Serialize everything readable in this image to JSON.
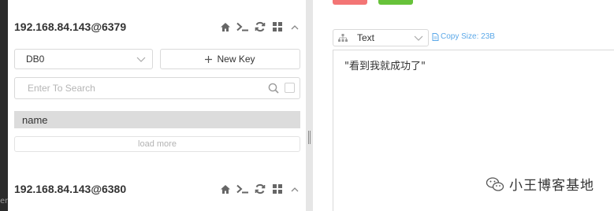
{
  "connections": [
    {
      "title": "192.168.84.143@6379",
      "icons": [
        "home-icon",
        "terminal-icon",
        "refresh-icon",
        "grid-icon",
        "chevron-up-icon"
      ],
      "db_select": {
        "value": "DB0"
      },
      "new_key_label": "New Key",
      "search": {
        "placeholder": "Enter To Search"
      },
      "keys": [
        "name"
      ],
      "load_more_label": "load more"
    },
    {
      "title": "192.168.84.143@6380",
      "icons": [
        "home-icon",
        "terminal-icon",
        "refresh-icon",
        "grid-icon",
        "chevron-up-icon"
      ]
    }
  ],
  "left_edge_fragment": "en",
  "detail": {
    "view_as": "Text",
    "copy_size_label": "Copy Size: 23B",
    "value_text": "\"看到我就成功了\""
  },
  "watermark": {
    "text": "小王博客基地"
  },
  "colors": {
    "delete_button": "#f37575",
    "save_button": "#67c23a",
    "link_blue": "#5ba8e8",
    "selected_key_bg": "#dcdcdc",
    "splitter": "#e6e6e6"
  }
}
